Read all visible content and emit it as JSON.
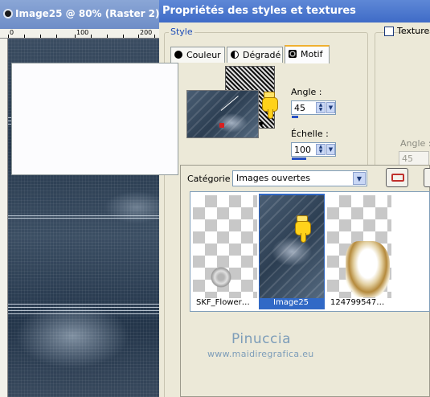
{
  "image_window": {
    "title": "Image25 @  80% (Raster 2)",
    "ruler_ticks": [
      "0",
      "100",
      "200"
    ]
  },
  "dialog": {
    "title": "Propriétés des styles et textures",
    "style_group_label": "Style",
    "tabs": [
      {
        "label": "Couleur",
        "icon": "circle-fill-icon"
      },
      {
        "label": "Dégradé",
        "icon": "half-circle-icon"
      },
      {
        "label": "Motif",
        "icon": "pattern-icon",
        "active": true
      }
    ],
    "angle": {
      "label": "Angle :",
      "value": "45"
    },
    "scale": {
      "label": "Échelle :",
      "value": "100"
    },
    "texture": {
      "label": "Texture",
      "checked": false,
      "angle_label": "Angle :",
      "angle_value": "45"
    }
  },
  "picker": {
    "category_label": "Catégorie :",
    "category_value": "Images ouvertes",
    "items": [
      {
        "caption": "SKF_Flower…",
        "selected": false
      },
      {
        "caption": "Image25",
        "selected": true
      },
      {
        "caption": "124799547…",
        "selected": false
      }
    ]
  },
  "watermark": {
    "name": "Pinuccia",
    "url": "www.maidiregrafica.eu"
  },
  "colors": {
    "title_active": "#3f6bc7",
    "selection": "#3169c6",
    "group_label": "#1c4cb8",
    "dialog_bg": "#ece9d8"
  }
}
